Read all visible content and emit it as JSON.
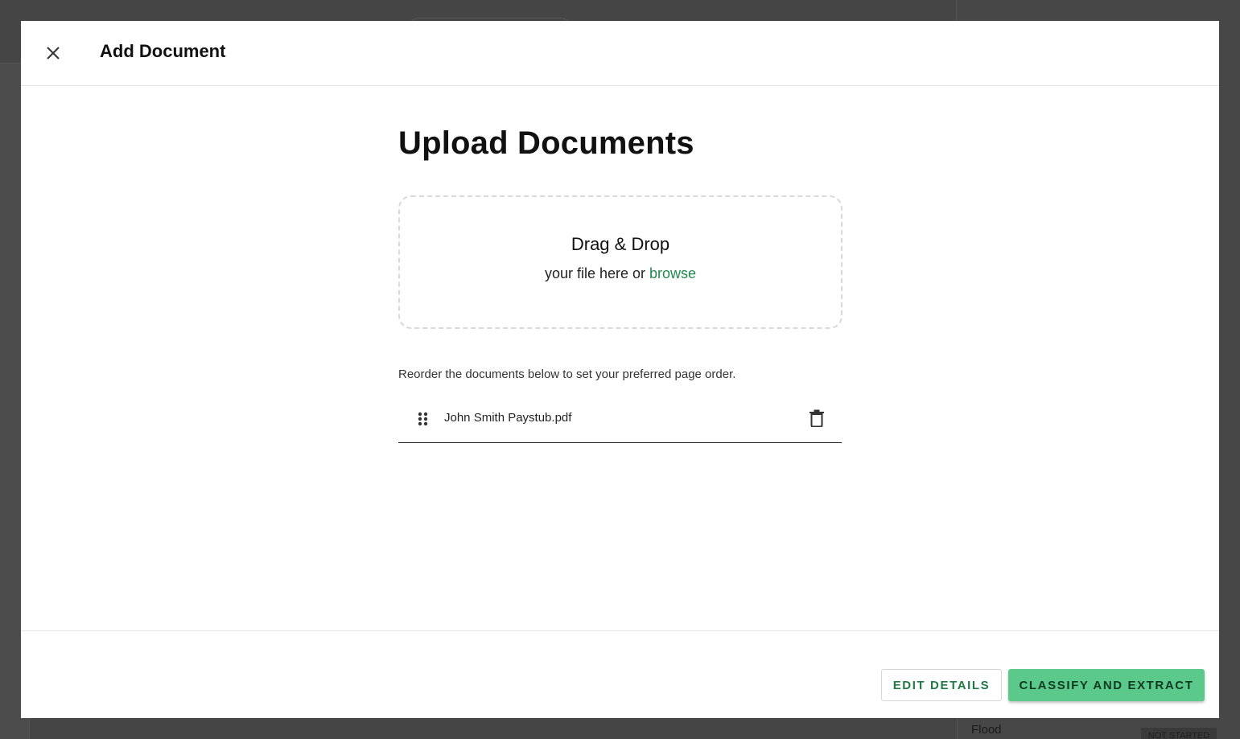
{
  "background": {
    "flood_label": "Flood",
    "badge": "NOT STARTED"
  },
  "modal": {
    "title": "Add Document",
    "close_icon": "close-icon"
  },
  "upload": {
    "heading": "Upload Documents",
    "dropzone_title": "Drag & Drop",
    "dropzone_text": "your file here or",
    "browse_link": "browse",
    "reorder_hint": "Reorder the documents below to set your preferred page order."
  },
  "documents": [
    {
      "name": "John Smith Paystub.pdf",
      "handle_icon": "drag-handle-icon",
      "delete_icon": "trash-icon"
    }
  ],
  "footer": {
    "edit_label": "EDIT DETAILS",
    "classify_label": "CLASSIFY AND EXTRACT"
  },
  "colors": {
    "accent_green": "#5bc98a",
    "link_green": "#1f8a4c",
    "overlay": "#424242"
  }
}
